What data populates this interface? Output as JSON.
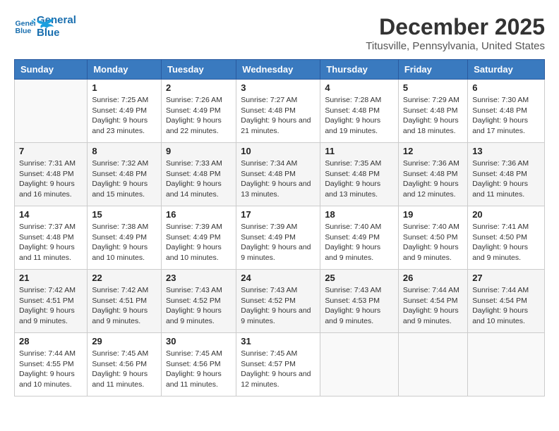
{
  "header": {
    "logo_line1": "General",
    "logo_line2": "Blue",
    "month": "December 2025",
    "location": "Titusville, Pennsylvania, United States"
  },
  "weekdays": [
    "Sunday",
    "Monday",
    "Tuesday",
    "Wednesday",
    "Thursday",
    "Friday",
    "Saturday"
  ],
  "weeks": [
    [
      {
        "day": "",
        "sunrise": "",
        "sunset": "",
        "daylight": ""
      },
      {
        "day": "1",
        "sunrise": "Sunrise: 7:25 AM",
        "sunset": "Sunset: 4:49 PM",
        "daylight": "Daylight: 9 hours and 23 minutes."
      },
      {
        "day": "2",
        "sunrise": "Sunrise: 7:26 AM",
        "sunset": "Sunset: 4:49 PM",
        "daylight": "Daylight: 9 hours and 22 minutes."
      },
      {
        "day": "3",
        "sunrise": "Sunrise: 7:27 AM",
        "sunset": "Sunset: 4:48 PM",
        "daylight": "Daylight: 9 hours and 21 minutes."
      },
      {
        "day": "4",
        "sunrise": "Sunrise: 7:28 AM",
        "sunset": "Sunset: 4:48 PM",
        "daylight": "Daylight: 9 hours and 19 minutes."
      },
      {
        "day": "5",
        "sunrise": "Sunrise: 7:29 AM",
        "sunset": "Sunset: 4:48 PM",
        "daylight": "Daylight: 9 hours and 18 minutes."
      },
      {
        "day": "6",
        "sunrise": "Sunrise: 7:30 AM",
        "sunset": "Sunset: 4:48 PM",
        "daylight": "Daylight: 9 hours and 17 minutes."
      }
    ],
    [
      {
        "day": "7",
        "sunrise": "Sunrise: 7:31 AM",
        "sunset": "Sunset: 4:48 PM",
        "daylight": "Daylight: 9 hours and 16 minutes."
      },
      {
        "day": "8",
        "sunrise": "Sunrise: 7:32 AM",
        "sunset": "Sunset: 4:48 PM",
        "daylight": "Daylight: 9 hours and 15 minutes."
      },
      {
        "day": "9",
        "sunrise": "Sunrise: 7:33 AM",
        "sunset": "Sunset: 4:48 PM",
        "daylight": "Daylight: 9 hours and 14 minutes."
      },
      {
        "day": "10",
        "sunrise": "Sunrise: 7:34 AM",
        "sunset": "Sunset: 4:48 PM",
        "daylight": "Daylight: 9 hours and 13 minutes."
      },
      {
        "day": "11",
        "sunrise": "Sunrise: 7:35 AM",
        "sunset": "Sunset: 4:48 PM",
        "daylight": "Daylight: 9 hours and 13 minutes."
      },
      {
        "day": "12",
        "sunrise": "Sunrise: 7:36 AM",
        "sunset": "Sunset: 4:48 PM",
        "daylight": "Daylight: 9 hours and 12 minutes."
      },
      {
        "day": "13",
        "sunrise": "Sunrise: 7:36 AM",
        "sunset": "Sunset: 4:48 PM",
        "daylight": "Daylight: 9 hours and 11 minutes."
      }
    ],
    [
      {
        "day": "14",
        "sunrise": "Sunrise: 7:37 AM",
        "sunset": "Sunset: 4:48 PM",
        "daylight": "Daylight: 9 hours and 11 minutes."
      },
      {
        "day": "15",
        "sunrise": "Sunrise: 7:38 AM",
        "sunset": "Sunset: 4:49 PM",
        "daylight": "Daylight: 9 hours and 10 minutes."
      },
      {
        "day": "16",
        "sunrise": "Sunrise: 7:39 AM",
        "sunset": "Sunset: 4:49 PM",
        "daylight": "Daylight: 9 hours and 10 minutes."
      },
      {
        "day": "17",
        "sunrise": "Sunrise: 7:39 AM",
        "sunset": "Sunset: 4:49 PM",
        "daylight": "Daylight: 9 hours and 9 minutes."
      },
      {
        "day": "18",
        "sunrise": "Sunrise: 7:40 AM",
        "sunset": "Sunset: 4:49 PM",
        "daylight": "Daylight: 9 hours and 9 minutes."
      },
      {
        "day": "19",
        "sunrise": "Sunrise: 7:40 AM",
        "sunset": "Sunset: 4:50 PM",
        "daylight": "Daylight: 9 hours and 9 minutes."
      },
      {
        "day": "20",
        "sunrise": "Sunrise: 7:41 AM",
        "sunset": "Sunset: 4:50 PM",
        "daylight": "Daylight: 9 hours and 9 minutes."
      }
    ],
    [
      {
        "day": "21",
        "sunrise": "Sunrise: 7:42 AM",
        "sunset": "Sunset: 4:51 PM",
        "daylight": "Daylight: 9 hours and 9 minutes."
      },
      {
        "day": "22",
        "sunrise": "Sunrise: 7:42 AM",
        "sunset": "Sunset: 4:51 PM",
        "daylight": "Daylight: 9 hours and 9 minutes."
      },
      {
        "day": "23",
        "sunrise": "Sunrise: 7:43 AM",
        "sunset": "Sunset: 4:52 PM",
        "daylight": "Daylight: 9 hours and 9 minutes."
      },
      {
        "day": "24",
        "sunrise": "Sunrise: 7:43 AM",
        "sunset": "Sunset: 4:52 PM",
        "daylight": "Daylight: 9 hours and 9 minutes."
      },
      {
        "day": "25",
        "sunrise": "Sunrise: 7:43 AM",
        "sunset": "Sunset: 4:53 PM",
        "daylight": "Daylight: 9 hours and 9 minutes."
      },
      {
        "day": "26",
        "sunrise": "Sunrise: 7:44 AM",
        "sunset": "Sunset: 4:54 PM",
        "daylight": "Daylight: 9 hours and 9 minutes."
      },
      {
        "day": "27",
        "sunrise": "Sunrise: 7:44 AM",
        "sunset": "Sunset: 4:54 PM",
        "daylight": "Daylight: 9 hours and 10 minutes."
      }
    ],
    [
      {
        "day": "28",
        "sunrise": "Sunrise: 7:44 AM",
        "sunset": "Sunset: 4:55 PM",
        "daylight": "Daylight: 9 hours and 10 minutes."
      },
      {
        "day": "29",
        "sunrise": "Sunrise: 7:45 AM",
        "sunset": "Sunset: 4:56 PM",
        "daylight": "Daylight: 9 hours and 11 minutes."
      },
      {
        "day": "30",
        "sunrise": "Sunrise: 7:45 AM",
        "sunset": "Sunset: 4:56 PM",
        "daylight": "Daylight: 9 hours and 11 minutes."
      },
      {
        "day": "31",
        "sunrise": "Sunrise: 7:45 AM",
        "sunset": "Sunset: 4:57 PM",
        "daylight": "Daylight: 9 hours and 12 minutes."
      },
      {
        "day": "",
        "sunrise": "",
        "sunset": "",
        "daylight": ""
      },
      {
        "day": "",
        "sunrise": "",
        "sunset": "",
        "daylight": ""
      },
      {
        "day": "",
        "sunrise": "",
        "sunset": "",
        "daylight": ""
      }
    ]
  ]
}
